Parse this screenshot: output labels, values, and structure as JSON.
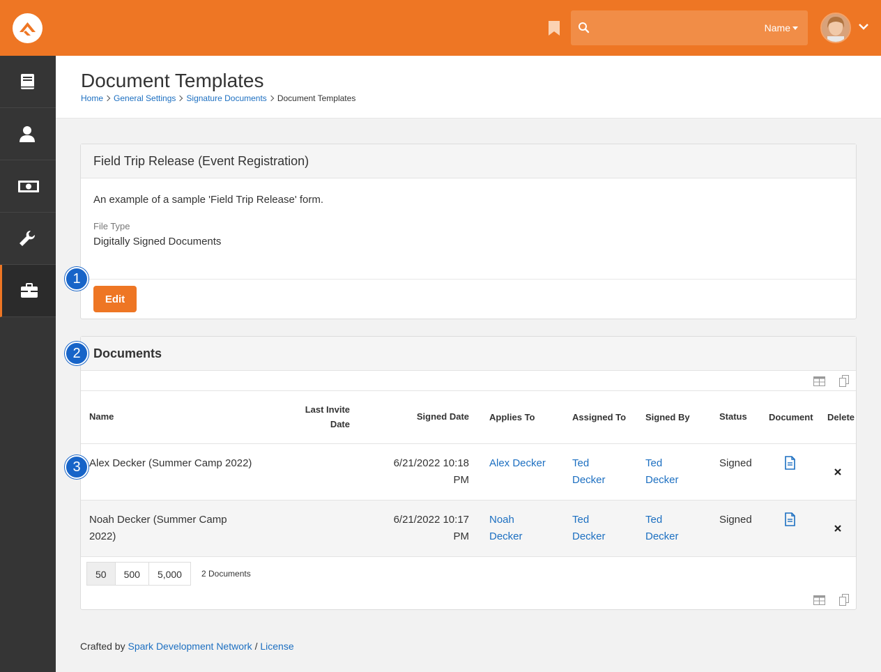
{
  "topbar": {
    "search_placeholder": "",
    "search_filter_label": "Name",
    "accent_color": "#ee7624"
  },
  "sidebar": {
    "items": [
      {
        "icon": "book-icon"
      },
      {
        "icon": "person-icon"
      },
      {
        "icon": "money-icon"
      },
      {
        "icon": "wrench-icon"
      },
      {
        "icon": "briefcase-icon",
        "active": true
      }
    ]
  },
  "header": {
    "title": "Document Templates",
    "breadcrumbs": [
      "Home",
      "General Settings",
      "Signature Documents",
      "Document Templates"
    ]
  },
  "template_panel": {
    "title": "Field Trip Release (Event Registration)",
    "description": "An example of a sample 'Field Trip Release' form.",
    "file_type_label": "File Type",
    "file_type_value": "Digitally Signed Documents",
    "edit_label": "Edit"
  },
  "documents_panel": {
    "title": "Documents",
    "columns": {
      "name": "Name",
      "last_invite_1": "Last Invite",
      "last_invite_2": "Date",
      "signed_date": "Signed Date",
      "applies_to": "Applies To",
      "assigned_to": "Assigned To",
      "signed_by": "Signed By",
      "status": "Status",
      "document": "Document",
      "delete": "Delete"
    },
    "rows": [
      {
        "name_1": "Alex Decker (Summer Camp 2022)",
        "name_2": "",
        "signed_1": "6/21/2022 10:18",
        "signed_2": "PM",
        "applies_1": "Alex Decker",
        "applies_2": "",
        "assigned_1": "Ted",
        "assigned_2": "Decker",
        "signedby_1": "Ted",
        "signedby_2": "Decker",
        "status": "Signed"
      },
      {
        "name_1": "Noah Decker (Summer Camp",
        "name_2": "2022)",
        "signed_1": "6/21/2022 10:17",
        "signed_2": "PM",
        "applies_1": "Noah",
        "applies_2": "Decker",
        "assigned_1": "Ted",
        "assigned_2": "Decker",
        "signedby_1": "Ted",
        "signedby_2": "Decker",
        "status": "Signed"
      }
    ],
    "page_sizes": [
      "50",
      "500",
      "5,000"
    ],
    "active_page_size": "50",
    "item_count": "2 Documents"
  },
  "callouts": [
    "1",
    "2",
    "3"
  ],
  "footer": {
    "prefix": "Crafted by",
    "link1": "Spark Development Network",
    "sep": "/",
    "link2": "License"
  }
}
